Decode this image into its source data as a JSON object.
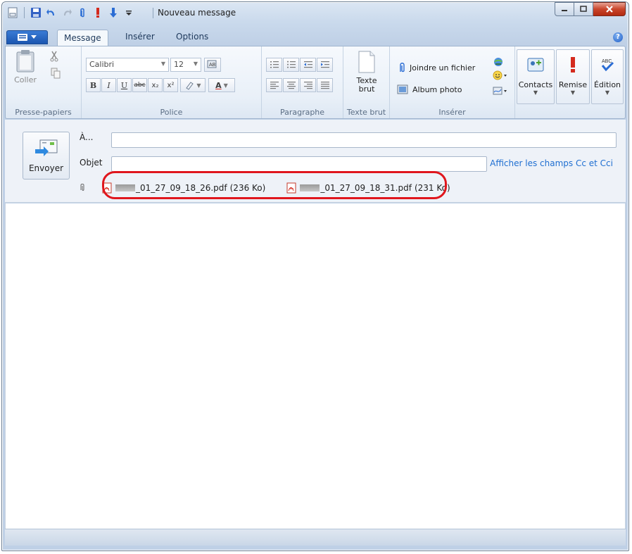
{
  "window": {
    "title": "Nouveau message",
    "accent": "#1b56b0"
  },
  "qat": {
    "icons": [
      "new-page-icon",
      "save-icon",
      "undo-icon",
      "redo-icon",
      "attach-icon",
      "priority-high-icon",
      "priority-low-icon",
      "customize-icon"
    ]
  },
  "ribbon": {
    "tabs": [
      {
        "label": "Message",
        "active": true
      },
      {
        "label": "Insérer",
        "active": false
      },
      {
        "label": "Options",
        "active": false
      }
    ],
    "groups": {
      "clipboard": {
        "label": "Presse-papiers",
        "paste": "Coller"
      },
      "font": {
        "label": "Police",
        "font_name": "Calibri",
        "font_size": "12"
      },
      "paragraph": {
        "label": "Paragraphe"
      },
      "plaintext": {
        "label": "Texte brut",
        "button_line1": "Texte",
        "button_line2": "brut"
      },
      "insert": {
        "label": "Insérer",
        "attach_file": "Joindre un fichier",
        "photo_album": "Album photo"
      },
      "contacts": "Contacts",
      "priority": "Remise",
      "editing": "Édition"
    }
  },
  "compose": {
    "send": "Envoyer",
    "to_label": "À...",
    "to_value": "",
    "subject_label": "Objet",
    "subject_value": "",
    "show_cc": "Afficher les champs Cc et Cci",
    "attachments": [
      {
        "name": "_01_27_09_18_26.pdf",
        "size": "(236 Ko)"
      },
      {
        "name": "_01_27_09_18_31.pdf",
        "size": "(231 Ko)"
      }
    ],
    "highlight_color": "#e0161d"
  }
}
